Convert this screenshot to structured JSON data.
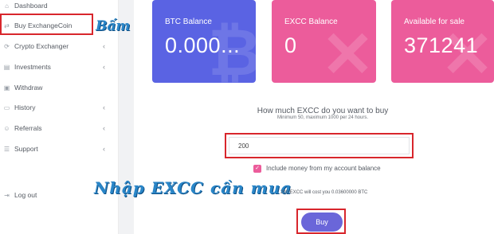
{
  "sidebar": {
    "items": [
      {
        "label": "Dashboard",
        "icon": "dashboard-icon",
        "glyph": "⌂",
        "chevron": ""
      },
      {
        "label": "Buy ExchangeCoin",
        "icon": "exchange-icon",
        "glyph": "⇄",
        "chevron": ""
      },
      {
        "label": "Crypto Exchanger",
        "icon": "refresh-icon",
        "glyph": "⟳",
        "chevron": "‹"
      },
      {
        "label": "Investments",
        "icon": "layers-icon",
        "glyph": "▤",
        "chevron": "‹"
      },
      {
        "label": "Withdraw",
        "icon": "image-icon",
        "glyph": "▣",
        "chevron": ""
      },
      {
        "label": "History",
        "icon": "folder-icon",
        "glyph": "▭",
        "chevron": "‹"
      },
      {
        "label": "Referrals",
        "icon": "user-icon",
        "glyph": "☺",
        "chevron": "‹"
      },
      {
        "label": "Support",
        "icon": "list-icon",
        "glyph": "☰",
        "chevron": "‹"
      },
      {
        "label": "Log out",
        "icon": "logout-icon",
        "glyph": "⇥",
        "chevron": ""
      }
    ]
  },
  "cards": [
    {
      "title": "BTC Balance",
      "value": "0.000...",
      "watermark": "₿",
      "color": "#5a63e3"
    },
    {
      "title": "EXCC Balance",
      "value": "0",
      "watermark": "✕",
      "color": "#ec5c9b"
    },
    {
      "title": "Available for sale",
      "value": "371241",
      "watermark": "✕",
      "color": "#ec5c9b"
    }
  ],
  "form": {
    "heading": "How much EXCC do you want to buy",
    "subheading": "Minimum 50, maximum 1000 per 24 hours.",
    "amount_value": "200",
    "checkbox_label": "Include money from my account balance",
    "checkbox_checked": true,
    "cost_text": "200 EXCC will cost you 0.03600000 BTC",
    "buy_label": "Buy"
  },
  "annotations": {
    "click_note": "Bấm",
    "enter_note": "Nhập EXCC cần mua"
  },
  "colors": {
    "highlight": "#d8262c",
    "annotation": "#2a86c8",
    "primary": "#6a66d9"
  }
}
